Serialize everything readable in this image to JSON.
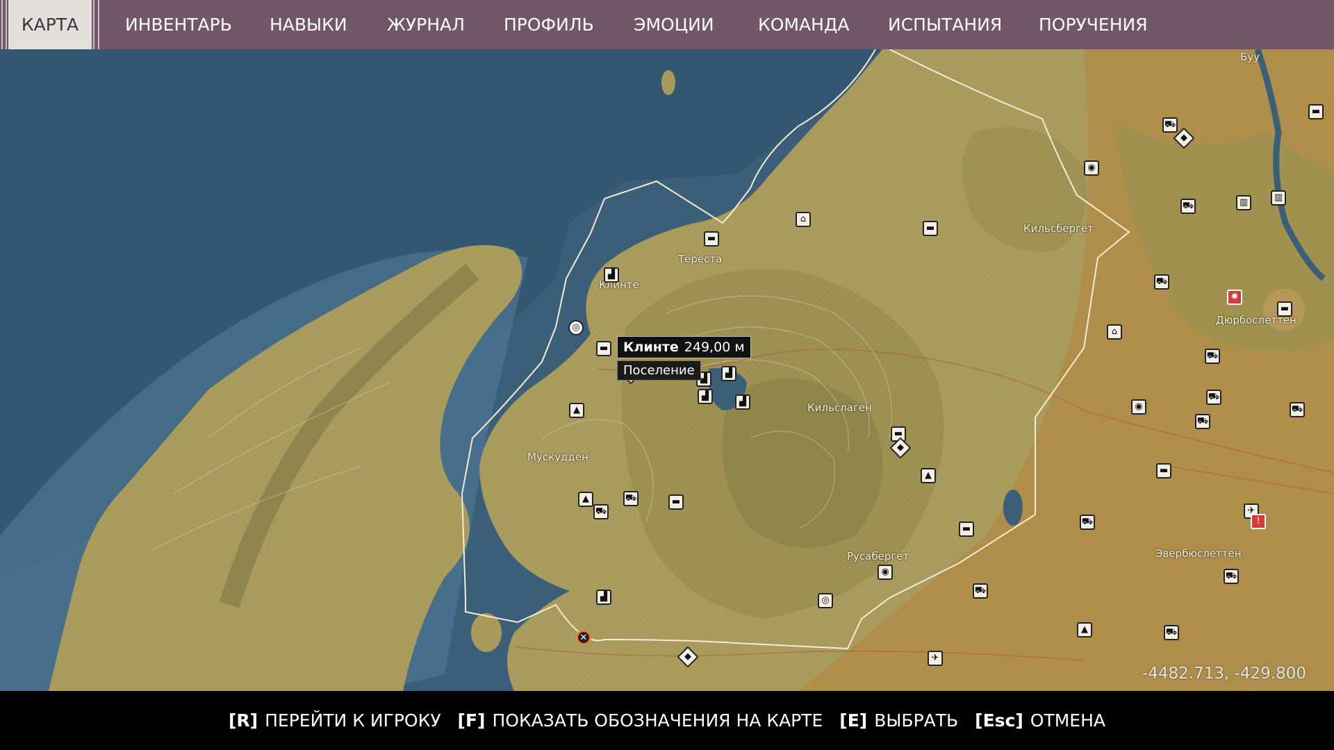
{
  "tabs": [
    {
      "label": "КАРТА",
      "active": true
    },
    {
      "label": "ИНВЕНТАРЬ"
    },
    {
      "label": "НАВЫКИ"
    },
    {
      "label": "ЖУРНАЛ"
    },
    {
      "label": "ПРОФИЛЬ"
    },
    {
      "label": "ЭМОЦИИ"
    },
    {
      "label": "КОМАНДА"
    },
    {
      "label": "ИСПЫТАНИЯ"
    },
    {
      "label": "ПОРУЧЕНИЯ"
    }
  ],
  "map": {
    "places": [
      "Кильсбергет",
      "Тёреста",
      "Клинте",
      "Кильслаген",
      "Мускудден",
      "Русабергет",
      "Дюрбослеттен",
      "Эвербюслеттен",
      "Буу"
    ],
    "tooltip": {
      "name": "Клинте",
      "distance": "249,00 м",
      "type": "Поселение"
    },
    "coordinates": "-4482.713, -429.800"
  },
  "hints": [
    {
      "key": "[R]",
      "label": "ПЕРЕЙТИ К ИГРОКУ"
    },
    {
      "key": "[F]",
      "label": "ПОКАЗАТЬ ОБОЗНАЧЕНИЯ НА КАРТЕ"
    },
    {
      "key": "[E]",
      "label": "ВЫБРАТЬ"
    },
    {
      "key": "[Esc]",
      "label": "ОТМЕНА"
    }
  ],
  "colors": {
    "topbar": "#725769",
    "water": "#3c5f79",
    "land": "#a89a5a",
    "farmland": "#b28a45"
  }
}
